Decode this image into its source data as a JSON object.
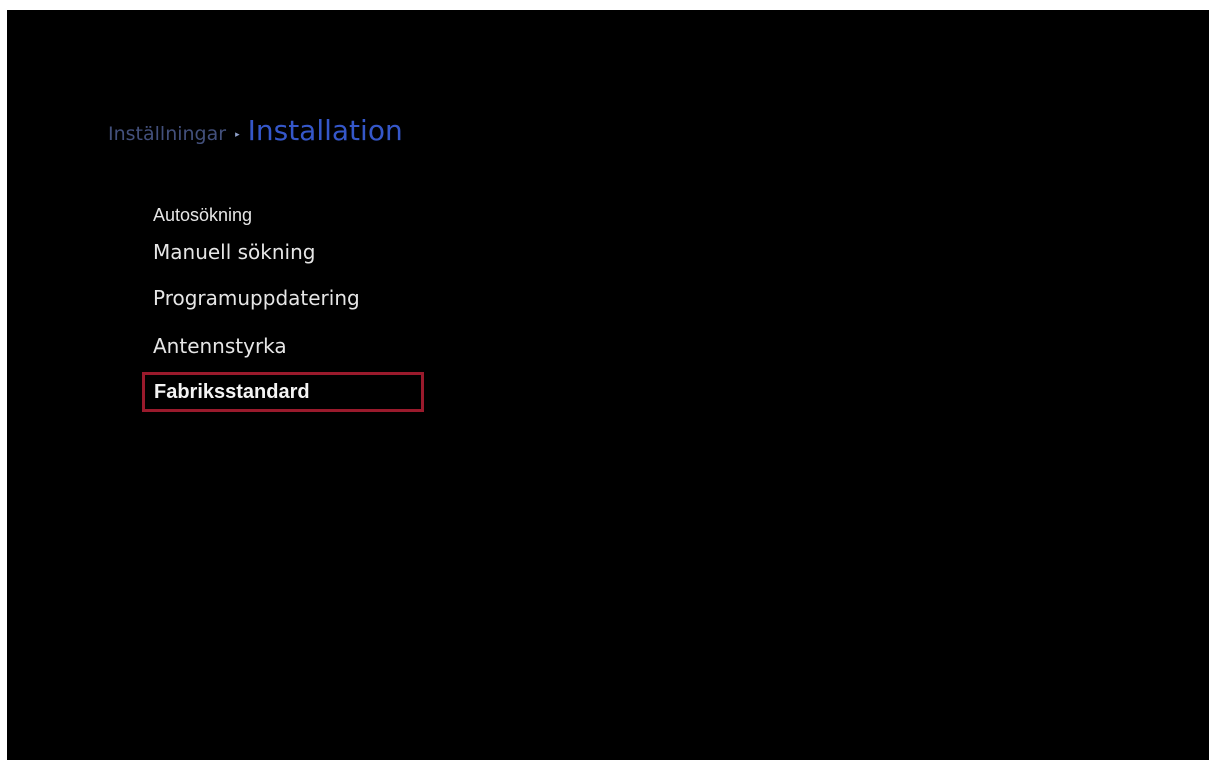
{
  "breadcrumb": {
    "parent": "Inställningar",
    "separator": "▸",
    "current": "Installation"
  },
  "menu": {
    "items": [
      {
        "label": "Autosökning"
      },
      {
        "label": "Manuell sökning"
      },
      {
        "label": "Programuppdatering"
      },
      {
        "label": "Antennstyrka"
      },
      {
        "label": "Fabriksstandard",
        "selected": true
      }
    ]
  },
  "colors": {
    "background": "#000000",
    "breadcrumb_parent": "#43507c",
    "breadcrumb_current": "#3557c9",
    "menu_text": "#e6e6e6",
    "selection_border": "#9a1a2c"
  }
}
